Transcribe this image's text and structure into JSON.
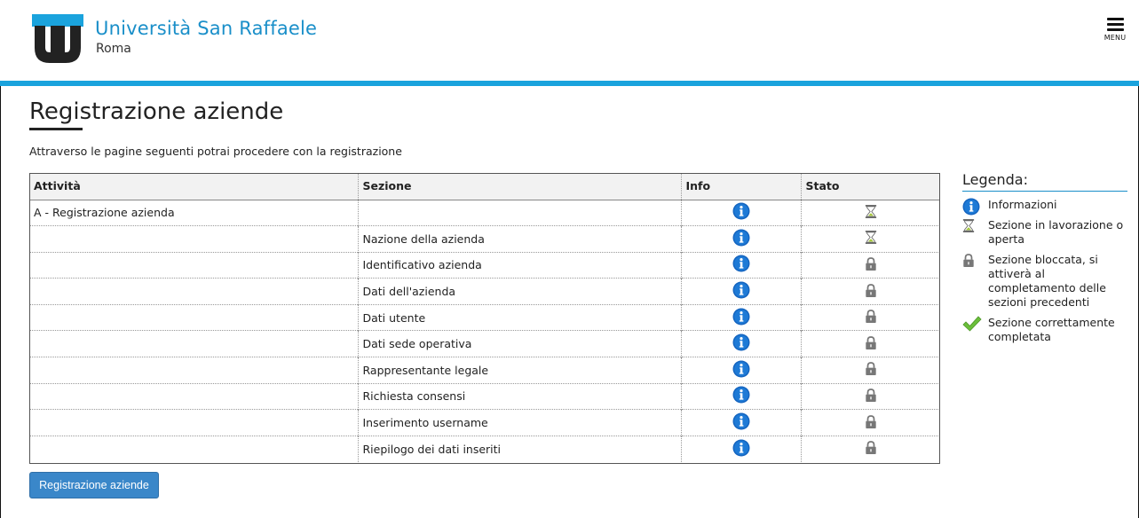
{
  "header": {
    "brand_name": "Università San Raffaele",
    "brand_city": "Roma",
    "menu_label": "MENU"
  },
  "page": {
    "title": "Registrazione aziende",
    "intro": "Attraverso le pagine seguenti potrai procedere con la registrazione"
  },
  "table": {
    "headers": [
      "Attività",
      "Sezione",
      "Info",
      "Stato"
    ],
    "rows": [
      {
        "attivita": "A - Registrazione azienda",
        "sezione": "",
        "info": "info-icon",
        "stato": "hourglass-icon"
      },
      {
        "attivita": "",
        "sezione": "Nazione della azienda",
        "info": "info-icon",
        "stato": "hourglass-icon"
      },
      {
        "attivita": "",
        "sezione": "Identificativo azienda",
        "info": "info-icon",
        "stato": "lock-icon"
      },
      {
        "attivita": "",
        "sezione": "Dati dell'azienda",
        "info": "info-icon",
        "stato": "lock-icon"
      },
      {
        "attivita": "",
        "sezione": "Dati utente",
        "info": "info-icon",
        "stato": "lock-icon"
      },
      {
        "attivita": "",
        "sezione": "Dati sede operativa",
        "info": "info-icon",
        "stato": "lock-icon"
      },
      {
        "attivita": "",
        "sezione": "Rappresentante legale",
        "info": "info-icon",
        "stato": "lock-icon"
      },
      {
        "attivita": "",
        "sezione": "Richiesta consensi",
        "info": "info-icon",
        "stato": "lock-icon"
      },
      {
        "attivita": "",
        "sezione": "Inserimento username",
        "info": "info-icon",
        "stato": "lock-icon"
      },
      {
        "attivita": "",
        "sezione": "Riepilogo dei dati inseriti",
        "info": "info-icon",
        "stato": "lock-icon"
      }
    ]
  },
  "legend": {
    "title": "Legenda:",
    "items": [
      {
        "icon": "info-icon",
        "label": "Informazioni"
      },
      {
        "icon": "hourglass-icon",
        "label": "Sezione in lavorazione o aperta"
      },
      {
        "icon": "lock-icon",
        "label": "Sezione bloccata, si attiverà al completamento delle sezioni precedenti"
      },
      {
        "icon": "checkmark-icon",
        "label": "Sezione correttamente completata"
      }
    ]
  },
  "actions": {
    "submit_label": "Registrazione aziende"
  },
  "colors": {
    "brand": "#1a8fc9",
    "header_bar": "#1aa3dd",
    "button": "#3a87c9",
    "info_icon": "#1565c0"
  }
}
